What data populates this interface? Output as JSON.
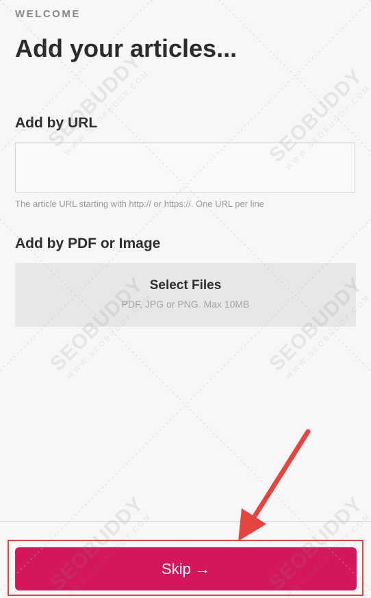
{
  "header": {
    "eyebrow": "WELCOME",
    "title": "Add your articles..."
  },
  "url_section": {
    "title": "Add by URL",
    "input_value": "",
    "hint": "The article URL starting with http:// or https://. One URL per line"
  },
  "file_section": {
    "title": "Add by PDF or Image",
    "button_label": "Select Files",
    "subtext": "PDF, JPG or PNG. Max 10MB"
  },
  "footer": {
    "skip_label": "Skip →"
  },
  "watermark": {
    "brand": "SEOBUDDY",
    "site": "WWW.SEOBUDDY.COM"
  },
  "colors": {
    "accent": "#d4175b",
    "annotation": "#e5443f",
    "background": "#f7f7f7"
  }
}
